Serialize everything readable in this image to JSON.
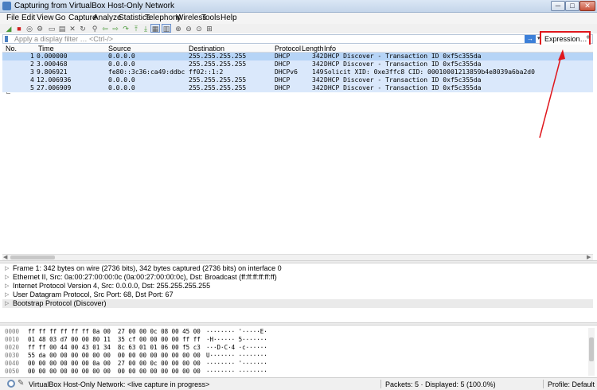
{
  "window": {
    "title": "Capturing from VirtualBox Host-Only Network",
    "min": "─",
    "max": "□",
    "close": "✕"
  },
  "menu": [
    "File",
    "Edit",
    "View",
    "Go",
    "Capture",
    "Analyze",
    "Statistics",
    "Telephony",
    "Wireless",
    "Tools",
    "Help"
  ],
  "toolbar": {
    "icons": [
      "shark-fin-icon",
      "stop-icon",
      "restart-icon",
      "options-gear-icon",
      "open-file-icon",
      "save-file-icon",
      "close-file-icon",
      "reload-icon",
      "find-packet-icon",
      "go-back-icon",
      "go-forward-icon",
      "go-to-packet-icon",
      "go-first-icon",
      "go-last-icon",
      "autoscroll-icon",
      "colorize-icon",
      "zoom-in-icon",
      "zoom-out-icon",
      "zoom-normal-icon",
      "resize-columns-icon"
    ],
    "glyphs": [
      "◢",
      "■",
      "◎",
      "⚙",
      "▭",
      "▤",
      "✕",
      "↻",
      "⚲",
      "⇦",
      "⇨",
      "↷",
      "⤒",
      "⤓",
      "▦",
      "▥",
      "⊕",
      "⊖",
      "⊙",
      "⊞"
    ]
  },
  "filter": {
    "placeholder": "Apply a display filter … <Ctrl-/>",
    "apply": "→",
    "dropdown": "▾",
    "expression_label": "Expression…",
    "add": "+"
  },
  "packet_list": {
    "columns": [
      "No.",
      "Time",
      "Source",
      "Destination",
      "Protocol",
      "Length",
      "Info"
    ],
    "rows": [
      {
        "no": "1",
        "time": "0.000000",
        "src": "0.0.0.0",
        "dst": "255.255.255.255",
        "proto": "DHCP",
        "len": "342",
        "info": "DHCP Discover - Transaction ID 0xf5c355da"
      },
      {
        "no": "2",
        "time": "3.000468",
        "src": "0.0.0.0",
        "dst": "255.255.255.255",
        "proto": "DHCP",
        "len": "342",
        "info": "DHCP Discover - Transaction ID 0xf5c355da"
      },
      {
        "no": "3",
        "time": "9.806921",
        "src": "fe80::3c36:ca49:ddbc:…",
        "dst": "ff02::1:2",
        "proto": "DHCPv6",
        "len": "149",
        "info": "Solicit XID: 0xe3ffc8 CID: 00010001213859b4e8039a6ba2d0"
      },
      {
        "no": "4",
        "time": "12.006936",
        "src": "0.0.0.0",
        "dst": "255.255.255.255",
        "proto": "DHCP",
        "len": "342",
        "info": "DHCP Discover - Transaction ID 0xf5c355da"
      },
      {
        "no": "5",
        "time": "27.006909",
        "src": "0.0.0.0",
        "dst": "255.255.255.255",
        "proto": "DHCP",
        "len": "342",
        "info": "DHCP Discover - Transaction ID 0xf5c355da"
      }
    ]
  },
  "scroll": {
    "left": "◀",
    "right": "▶"
  },
  "details": {
    "arrow": "▷",
    "items": [
      "Frame 1: 342 bytes on wire (2736 bits), 342 bytes captured (2736 bits) on interface 0",
      "Ethernet II, Src: 0a:00:27:00:00:0c (0a:00:27:00:00:0c), Dst: Broadcast (ff:ff:ff:ff:ff:ff)",
      "Internet Protocol Version 4, Src: 0.0.0.0, Dst: 255.255.255.255",
      "User Datagram Protocol, Src Port: 68, Dst Port: 67",
      "Bootstrap Protocol (Discover)"
    ]
  },
  "bytes": [
    {
      "offset": "0000",
      "hex": "ff ff ff ff ff ff 0a 00  27 00 00 0c 08 00 45 00",
      "ascii": "········ '·····E·"
    },
    {
      "offset": "0010",
      "hex": "01 48 03 d7 00 00 80 11  35 cf 00 00 00 00 ff ff",
      "ascii": "·H······ 5·······"
    },
    {
      "offset": "0020",
      "hex": "ff ff 00 44 00 43 01 34  8c 63 01 01 06 00 f5 c3",
      "ascii": "···D·C·4 ·c······"
    },
    {
      "offset": "0030",
      "hex": "55 da 00 00 00 00 00 00  00 00 00 00 00 00 00 00",
      "ascii": "U······· ········"
    },
    {
      "offset": "0040",
      "hex": "00 00 00 00 00 00 0a 00  27 00 00 0c 00 00 00 00",
      "ascii": "········ '·······"
    },
    {
      "offset": "0050",
      "hex": "00 00 00 00 00 00 00 00  00 00 00 00 00 00 00 00",
      "ascii": "········ ········"
    }
  ],
  "status": {
    "interface": "VirtualBox Host-Only Network: <live capture in progress>",
    "packets": "Packets: 5 · Displayed: 5 (100.0%)",
    "profile": "Profile: Default"
  },
  "colors": {
    "annotation": "#e0161c",
    "row": "#dae8fb",
    "row_selected": "#b6d4f6"
  }
}
